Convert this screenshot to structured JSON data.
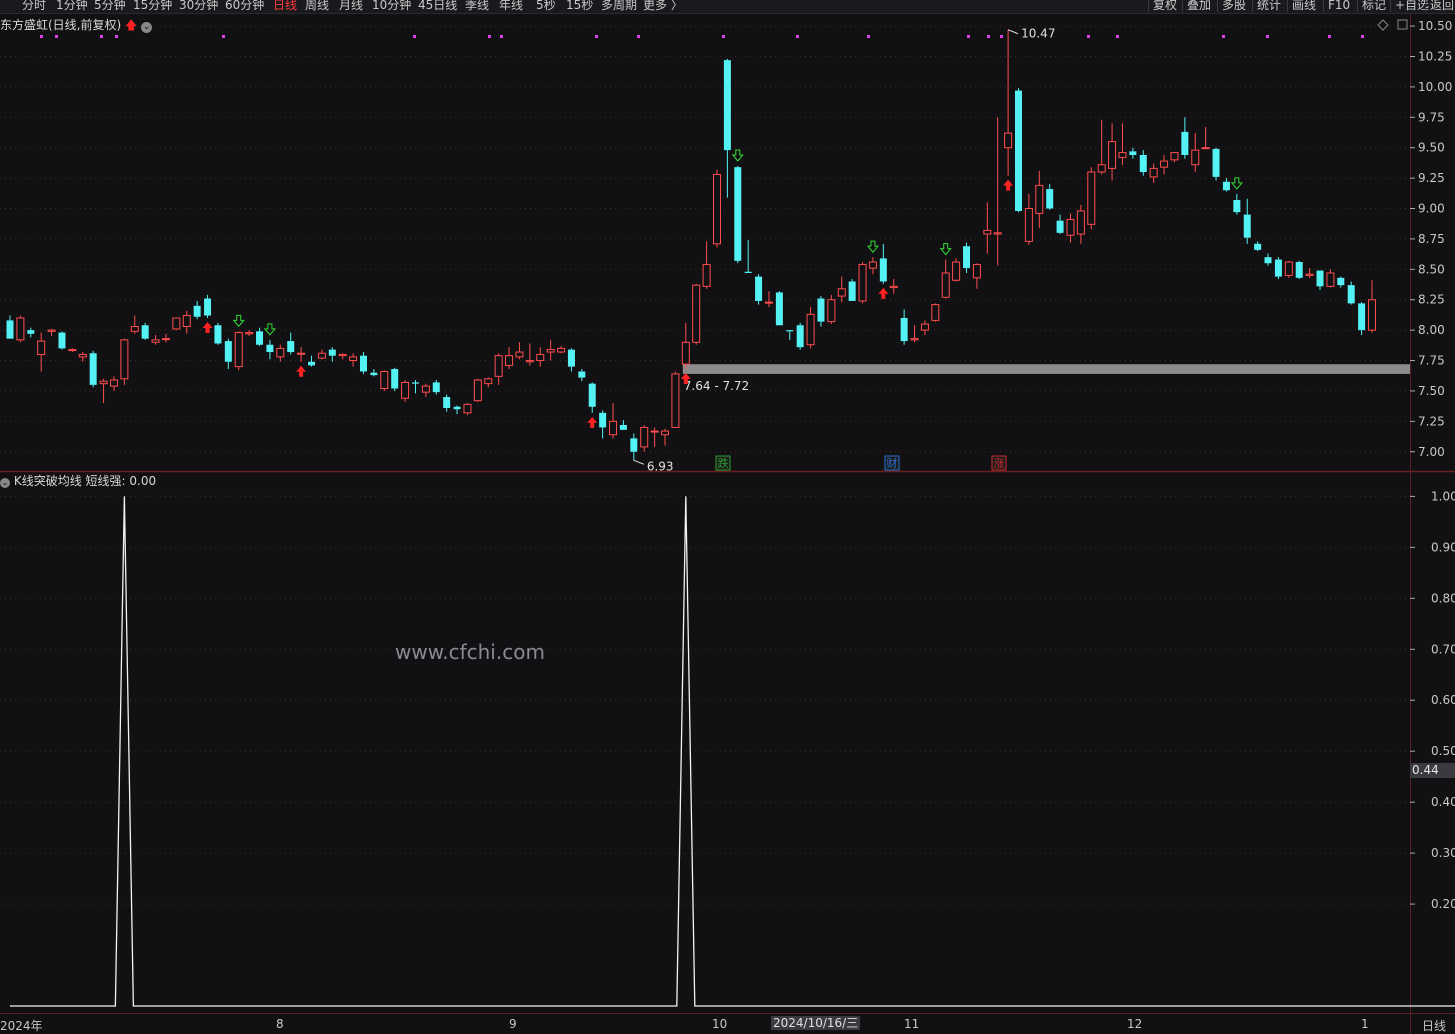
{
  "toolbar": {
    "periods": [
      "分时",
      "1分钟",
      "5分钟",
      "15分钟",
      "30分钟",
      "60分钟",
      "日线",
      "周线",
      "月线",
      "10分钟",
      "45日线",
      "季线",
      "年线",
      "5秒",
      "15秒",
      "多周期",
      "更多 〉"
    ],
    "active_period": "日线",
    "right_buttons": [
      "复权",
      "叠加",
      "多股",
      "统计",
      "画线",
      "F10",
      "标记",
      "+自选",
      "返回"
    ]
  },
  "main_panel": {
    "title": "东方盛虹(日线,前复权)",
    "high_label": "10.47",
    "low_label": "6.93",
    "gap_label": "7.64 - 7.72",
    "event_markers": [
      "跌",
      "财",
      "涨"
    ]
  },
  "sub_panel": {
    "title": "K线突破均线",
    "series_label": "短线强:",
    "series_value": "0.00",
    "current_axis_value": "0.44"
  },
  "date_axis": {
    "labels": [
      "2024年",
      "8",
      "9",
      "10",
      "11",
      "12",
      "1"
    ],
    "crosshair_date": "2024/10/16/三",
    "period_label": "日线"
  },
  "watermark": "www.cfchi.com",
  "colors": {
    "up": "#ff4d4d",
    "down": "#54f2f4",
    "background": "#111114",
    "grid": "#4a2222",
    "magenta_dots": "#e040e0",
    "buy_arrow": "#ff2222",
    "sell_arrow": "#33dd33",
    "gap_band": "#8c8c8c"
  },
  "chart_data": [
    {
      "type": "candlestick",
      "title": "东方盛虹(日线,前复权)",
      "ylim": [
        6.85,
        10.55
      ],
      "y_ticks": [
        7.0,
        7.25,
        7.5,
        7.75,
        8.0,
        8.25,
        8.5,
        8.75,
        9.0,
        9.25,
        9.5,
        9.75,
        10.0,
        10.25,
        10.5
      ],
      "ohlc": [
        [
          8.08,
          8.12,
          7.93,
          7.93
        ],
        [
          7.92,
          8.12,
          7.9,
          8.1
        ],
        [
          8.0,
          8.02,
          7.94,
          7.97
        ],
        [
          7.8,
          7.98,
          7.66,
          7.91
        ],
        [
          7.99,
          8.01,
          7.95,
          8.0
        ],
        [
          7.98,
          7.99,
          7.84,
          7.85
        ],
        [
          7.84,
          7.85,
          7.82,
          7.84
        ],
        [
          7.78,
          7.82,
          7.74,
          7.8
        ],
        [
          7.81,
          7.83,
          7.53,
          7.55
        ],
        [
          7.56,
          7.6,
          7.4,
          7.58
        ],
        [
          7.54,
          7.62,
          7.5,
          7.59
        ],
        [
          7.6,
          7.93,
          7.55,
          7.92
        ],
        [
          7.99,
          8.12,
          7.97,
          8.03
        ],
        [
          8.04,
          8.06,
          7.92,
          7.93
        ],
        [
          7.9,
          7.96,
          7.88,
          7.92
        ],
        [
          7.93,
          7.97,
          7.9,
          7.93
        ],
        [
          8.01,
          8.1,
          8.0,
          8.1
        ],
        [
          8.03,
          8.16,
          7.97,
          8.12
        ],
        [
          8.2,
          8.24,
          8.09,
          8.11
        ],
        [
          8.26,
          8.29,
          8.1,
          8.12
        ],
        [
          8.04,
          8.06,
          7.88,
          7.89
        ],
        [
          7.91,
          7.93,
          7.68,
          7.74
        ],
        [
          7.7,
          7.99,
          7.67,
          7.98
        ],
        [
          7.97,
          8.0,
          7.95,
          7.98
        ],
        [
          7.99,
          8.02,
          7.87,
          7.88
        ],
        [
          7.88,
          7.92,
          7.76,
          7.82
        ],
        [
          7.78,
          7.88,
          7.74,
          7.85
        ],
        [
          7.91,
          7.98,
          7.8,
          7.82
        ],
        [
          7.81,
          7.86,
          7.74,
          7.81
        ],
        [
          7.74,
          7.79,
          7.7,
          7.71
        ],
        [
          7.77,
          7.84,
          7.76,
          7.81
        ],
        [
          7.84,
          7.86,
          7.74,
          7.79
        ],
        [
          7.79,
          7.81,
          7.76,
          7.8
        ],
        [
          7.75,
          7.81,
          7.7,
          7.78
        ],
        [
          7.79,
          7.82,
          7.64,
          7.66
        ],
        [
          7.65,
          7.68,
          7.62,
          7.63
        ],
        [
          7.52,
          7.67,
          7.5,
          7.66
        ],
        [
          7.68,
          7.69,
          7.5,
          7.52
        ],
        [
          7.44,
          7.59,
          7.41,
          7.57
        ],
        [
          7.57,
          7.59,
          7.48,
          7.56
        ],
        [
          7.49,
          7.56,
          7.45,
          7.54
        ],
        [
          7.57,
          7.59,
          7.47,
          7.49
        ],
        [
          7.45,
          7.47,
          7.33,
          7.36
        ],
        [
          7.37,
          7.38,
          7.31,
          7.35
        ],
        [
          7.32,
          7.4,
          7.3,
          7.39
        ],
        [
          7.42,
          7.6,
          7.41,
          7.59
        ],
        [
          7.56,
          7.61,
          7.53,
          7.6
        ],
        [
          7.62,
          7.81,
          7.55,
          7.79
        ],
        [
          7.71,
          7.86,
          7.68,
          7.79
        ],
        [
          7.78,
          7.9,
          7.76,
          7.82
        ],
        [
          7.74,
          7.89,
          7.71,
          7.75
        ],
        [
          7.75,
          7.86,
          7.7,
          7.8
        ],
        [
          7.82,
          7.92,
          7.75,
          7.84
        ],
        [
          7.82,
          7.87,
          7.81,
          7.85
        ],
        [
          7.84,
          7.85,
          7.66,
          7.7
        ],
        [
          7.66,
          7.68,
          7.58,
          7.61
        ],
        [
          7.56,
          7.57,
          7.32,
          7.37
        ],
        [
          7.32,
          7.34,
          7.11,
          7.2
        ],
        [
          7.14,
          7.4,
          7.11,
          7.25
        ],
        [
          7.22,
          7.26,
          7.18,
          7.18
        ],
        [
          7.11,
          7.15,
          6.93,
          7.0
        ],
        [
          7.04,
          7.22,
          7.0,
          7.2
        ],
        [
          7.17,
          7.2,
          7.04,
          7.17
        ],
        [
          7.14,
          7.19,
          7.05,
          7.17
        ],
        [
          7.2,
          7.66,
          7.2,
          7.64
        ],
        [
          7.72,
          8.06,
          7.68,
          7.9
        ],
        [
          7.9,
          8.38,
          7.88,
          8.37
        ],
        [
          8.36,
          8.73,
          8.34,
          8.54
        ],
        [
          8.71,
          9.32,
          8.68,
          9.28
        ],
        [
          10.22,
          10.23,
          9.09,
          9.48
        ],
        [
          9.34,
          9.35,
          8.55,
          8.57
        ],
        [
          8.48,
          8.74,
          8.47,
          8.47
        ],
        [
          8.44,
          8.46,
          8.21,
          8.24
        ],
        [
          8.23,
          8.32,
          8.19,
          8.23
        ],
        [
          8.31,
          8.32,
          8.04,
          8.04
        ],
        [
          8.0,
          8.0,
          7.92,
          7.99
        ],
        [
          8.04,
          8.06,
          7.84,
          7.86
        ],
        [
          7.88,
          8.19,
          7.85,
          8.13
        ],
        [
          8.26,
          8.28,
          8.03,
          8.07
        ],
        [
          8.07,
          8.29,
          8.05,
          8.25
        ],
        [
          8.28,
          8.44,
          8.23,
          8.34
        ],
        [
          8.4,
          8.42,
          8.24,
          8.24
        ],
        [
          8.24,
          8.56,
          8.22,
          8.54
        ],
        [
          8.51,
          8.6,
          8.46,
          8.56
        ],
        [
          8.59,
          8.71,
          8.38,
          8.4
        ],
        [
          8.35,
          8.42,
          8.3,
          8.36
        ],
        [
          8.1,
          8.17,
          7.88,
          7.91
        ],
        [
          7.92,
          8.04,
          7.9,
          7.93
        ],
        [
          8.0,
          8.08,
          7.96,
          8.05
        ],
        [
          8.08,
          8.22,
          8.07,
          8.21
        ],
        [
          8.27,
          8.58,
          8.26,
          8.47
        ],
        [
          8.41,
          8.59,
          8.4,
          8.56
        ],
        [
          8.69,
          8.72,
          8.47,
          8.51
        ],
        [
          8.43,
          8.55,
          8.34,
          8.54
        ],
        [
          8.79,
          9.05,
          8.63,
          8.82
        ],
        [
          8.79,
          9.75,
          8.53,
          8.8
        ],
        [
          9.5,
          10.47,
          9.27,
          9.62
        ],
        [
          9.97,
          9.99,
          8.97,
          8.98
        ],
        [
          8.73,
          9.12,
          8.7,
          9.0
        ],
        [
          8.96,
          9.31,
          8.84,
          9.19
        ],
        [
          9.16,
          9.2,
          8.99,
          9.0
        ],
        [
          8.9,
          8.95,
          8.79,
          8.8
        ],
        [
          8.78,
          8.96,
          8.72,
          8.91
        ],
        [
          8.79,
          9.03,
          8.71,
          8.98
        ],
        [
          8.87,
          9.34,
          8.83,
          9.3
        ],
        [
          9.3,
          9.73,
          9.28,
          9.36
        ],
        [
          9.33,
          9.7,
          9.23,
          9.55
        ],
        [
          9.42,
          9.7,
          9.36,
          9.46
        ],
        [
          9.47,
          9.5,
          9.41,
          9.44
        ],
        [
          9.44,
          9.48,
          9.27,
          9.3
        ],
        [
          9.26,
          9.37,
          9.21,
          9.33
        ],
        [
          9.34,
          9.44,
          9.28,
          9.39
        ],
        [
          9.4,
          9.45,
          9.38,
          9.46
        ],
        [
          9.63,
          9.75,
          9.41,
          9.44
        ],
        [
          9.36,
          9.62,
          9.3,
          9.48
        ],
        [
          9.5,
          9.67,
          9.49,
          9.5
        ],
        [
          9.49,
          9.5,
          9.23,
          9.26
        ],
        [
          9.22,
          9.25,
          9.14,
          9.15
        ],
        [
          9.07,
          9.12,
          8.95,
          8.97
        ],
        [
          8.95,
          9.08,
          8.71,
          8.76
        ],
        [
          8.71,
          8.73,
          8.65,
          8.66
        ],
        [
          8.6,
          8.63,
          8.53,
          8.55
        ],
        [
          8.58,
          8.6,
          8.42,
          8.44
        ],
        [
          8.45,
          8.57,
          8.43,
          8.56
        ],
        [
          8.56,
          8.57,
          8.42,
          8.43
        ],
        [
          8.45,
          8.51,
          8.43,
          8.46
        ],
        [
          8.49,
          8.49,
          8.33,
          8.36
        ],
        [
          8.36,
          8.5,
          8.35,
          8.47
        ],
        [
          8.43,
          8.44,
          8.35,
          8.37
        ],
        [
          8.37,
          8.4,
          8.21,
          8.22
        ],
        [
          8.22,
          8.23,
          7.96,
          8.0
        ],
        [
          8.0,
          8.41,
          7.98,
          8.25
        ]
      ],
      "buy_signal_indices": [
        19,
        28,
        56,
        65,
        84,
        96
      ],
      "sell_signal_indices": [
        22,
        25,
        70,
        83,
        90,
        118
      ],
      "annotations": {
        "high": "10.47",
        "low": "6.93",
        "gap_zone": "7.64 - 7.72"
      }
    },
    {
      "type": "line",
      "title": "K线突破均线",
      "series": [
        {
          "name": "短线强",
          "values": [
            0,
            0,
            0,
            0,
            0,
            0,
            0,
            0,
            0,
            0,
            0,
            1,
            0,
            0,
            0,
            0,
            0,
            0,
            0,
            0,
            0,
            0,
            0,
            0,
            0,
            0,
            0,
            0,
            0,
            0,
            0,
            0,
            0,
            0,
            0,
            0,
            0,
            0,
            0,
            0,
            0,
            0,
            0,
            0,
            0,
            0,
            0,
            0,
            0,
            0,
            0,
            0,
            0,
            0,
            0,
            0,
            0,
            0,
            0,
            0,
            0,
            0,
            0,
            0,
            0,
            1,
            0,
            0,
            0,
            0,
            0,
            0,
            0,
            0,
            0,
            0,
            0,
            0,
            0,
            0,
            0,
            0,
            0,
            0,
            0,
            0,
            0,
            0,
            0,
            0,
            0,
            0,
            0,
            0,
            0,
            0,
            0,
            0,
            0,
            0,
            0,
            0,
            0,
            0,
            0,
            0,
            0,
            0,
            0,
            0,
            0,
            0,
            0,
            0,
            0,
            0,
            0,
            0,
            0,
            0,
            0,
            0,
            0,
            0,
            0,
            0,
            0,
            0,
            0,
            0,
            0,
            0,
            0,
            0,
            0,
            0,
            0,
            0,
            0,
            0,
            0,
            0,
            0
          ]
        }
      ],
      "ylim": [
        0.0,
        1.04
      ],
      "y_ticks": [
        "0.20",
        "0.30",
        "0.40",
        "0.50",
        "0.60",
        "0.70",
        "0.80",
        "0.90",
        "1.00"
      ]
    }
  ]
}
